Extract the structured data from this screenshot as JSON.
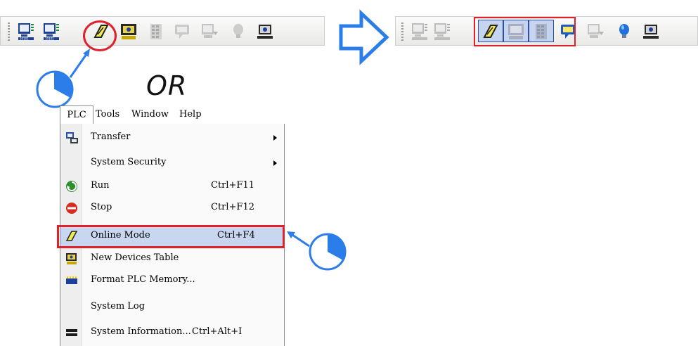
{
  "toolbar_before": {
    "icons": [
      "monitor-download-icon",
      "monitor-upload-icon",
      "online-mode-icon",
      "new-devices-table-icon",
      "memory-grid-icon",
      "monitor-chat-icon",
      "monitor-arrow-icon",
      "bulb-icon",
      "network-monitor-icon"
    ]
  },
  "toolbar_after": {
    "icons": [
      "monitor-download-icon",
      "monitor-upload-icon",
      "online-mode-icon",
      "new-devices-table-icon",
      "memory-grid-icon",
      "monitor-chat-icon",
      "monitor-arrow-icon",
      "bulb-icon",
      "network-monitor-icon"
    ]
  },
  "or_label": "OR",
  "menubar": {
    "items": [
      "PLC",
      "Tools",
      "Window",
      "Help"
    ]
  },
  "menu": {
    "items": [
      {
        "label": "Transfer",
        "shortcut": "",
        "submenu": true,
        "icon": "transfer-icon"
      },
      {
        "label": "System Security",
        "shortcut": "",
        "submenu": true,
        "icon": ""
      },
      {
        "label": "Run",
        "shortcut": "Ctrl+F11",
        "submenu": false,
        "icon": "run-icon"
      },
      {
        "label": "Stop",
        "shortcut": "Ctrl+F12",
        "submenu": false,
        "icon": "stop-icon"
      },
      {
        "label": "Online Mode",
        "shortcut": "Ctrl+F4",
        "submenu": false,
        "icon": "online-mode-icon",
        "highlighted": true
      },
      {
        "label": "New Devices Table",
        "shortcut": "",
        "submenu": false,
        "icon": "new-devices-table-icon"
      },
      {
        "label": "Format PLC Memory...",
        "shortcut": "",
        "submenu": false,
        "icon": "format-memory-icon"
      },
      {
        "label": "System Log",
        "shortcut": "",
        "submenu": false,
        "icon": ""
      },
      {
        "label": "System Information...",
        "shortcut": "Ctrl+Alt+I",
        "submenu": false,
        "icon": "system-information-icon"
      }
    ]
  },
  "colors": {
    "highlight_red": "#e0202a",
    "arrow_blue": "#2b7de9",
    "menu_highlight": "#c8d6ef"
  }
}
